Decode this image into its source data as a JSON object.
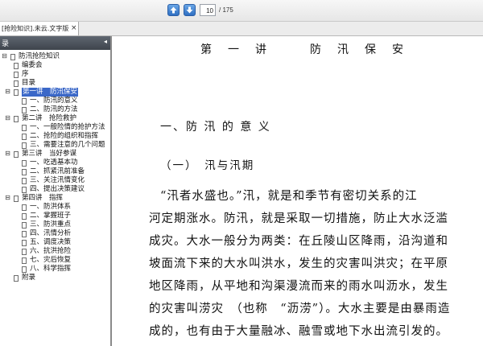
{
  "toolbar": {
    "current_page": "10",
    "total_pages": "/ 175"
  },
  "tab": {
    "title": "[抢险知识].未云.文字版",
    "close": "×"
  },
  "sidebar": {
    "title": "录",
    "collapse": "◂"
  },
  "bookmarks": [
    {
      "label": "防汛抢险知识",
      "level": 0,
      "toggle": "⊟"
    },
    {
      "label": "编委会",
      "level": 1
    },
    {
      "label": "序",
      "level": 1
    },
    {
      "label": "目录",
      "level": 1
    },
    {
      "label": "第一讲　防汛保安",
      "level": 1,
      "toggle": "⊟",
      "selected": true
    },
    {
      "label": "一、防汛的意义",
      "level": 2
    },
    {
      "label": "二、防汛的方法",
      "level": 2
    },
    {
      "label": "第二讲　抢险救护",
      "level": 1,
      "toggle": "⊟"
    },
    {
      "label": "一、一般险情的抢护方法",
      "level": 2
    },
    {
      "label": "二、抢险的组织和指挥",
      "level": 2
    },
    {
      "label": "三、需要注意的几个问题",
      "level": 2
    },
    {
      "label": "第三讲　当好参谋",
      "level": 1,
      "toggle": "⊟"
    },
    {
      "label": "一、吃透基本功",
      "level": 2
    },
    {
      "label": "二、抓紧汛前准备",
      "level": 2
    },
    {
      "label": "三、关注汛情变化",
      "level": 2
    },
    {
      "label": "四、提出决策建议",
      "level": 2
    },
    {
      "label": "第四讲　指挥",
      "level": 1,
      "toggle": "⊟"
    },
    {
      "label": "一、防洪体系",
      "level": 2
    },
    {
      "label": "二、掌握班子",
      "level": 2
    },
    {
      "label": "三、防洪重点",
      "level": 2
    },
    {
      "label": "四、汛情分析",
      "level": 2
    },
    {
      "label": "五、调度决策",
      "level": 2
    },
    {
      "label": "六、抗洪抢险",
      "level": 2
    },
    {
      "label": "七、灾后恢复",
      "level": 2
    },
    {
      "label": "八、科学指挥",
      "level": 2
    },
    {
      "label": "附录",
      "level": 1
    }
  ],
  "document": {
    "lecture_heading": "第　一　讲　　　防　汛　保　安",
    "section_heading": "一、防 汛 的 意 义",
    "subsection_heading": "（一）　汛与汛期",
    "paragraph_lines": [
      "“汛者水盛也。”汛，就是和季节有密切关系的江",
      "河定期涨水。防汛，就是采取一切措施，防止大水泛滥",
      "成灾。大水一般分为两类：在丘陵山区降雨，沿沟道和",
      "坡面流下来的大水叫洪水，发生的灾害叫洪灾；在平原",
      "地区降雨，从平地和沟渠漫流而来的雨水叫沥水，发生",
      "的灾害叫涝灾　（也称　“沥涝”）。大水主要是由暴雨造",
      "成的，也有由于大量融冰、融雪或地下水出流引发的。"
    ]
  }
}
